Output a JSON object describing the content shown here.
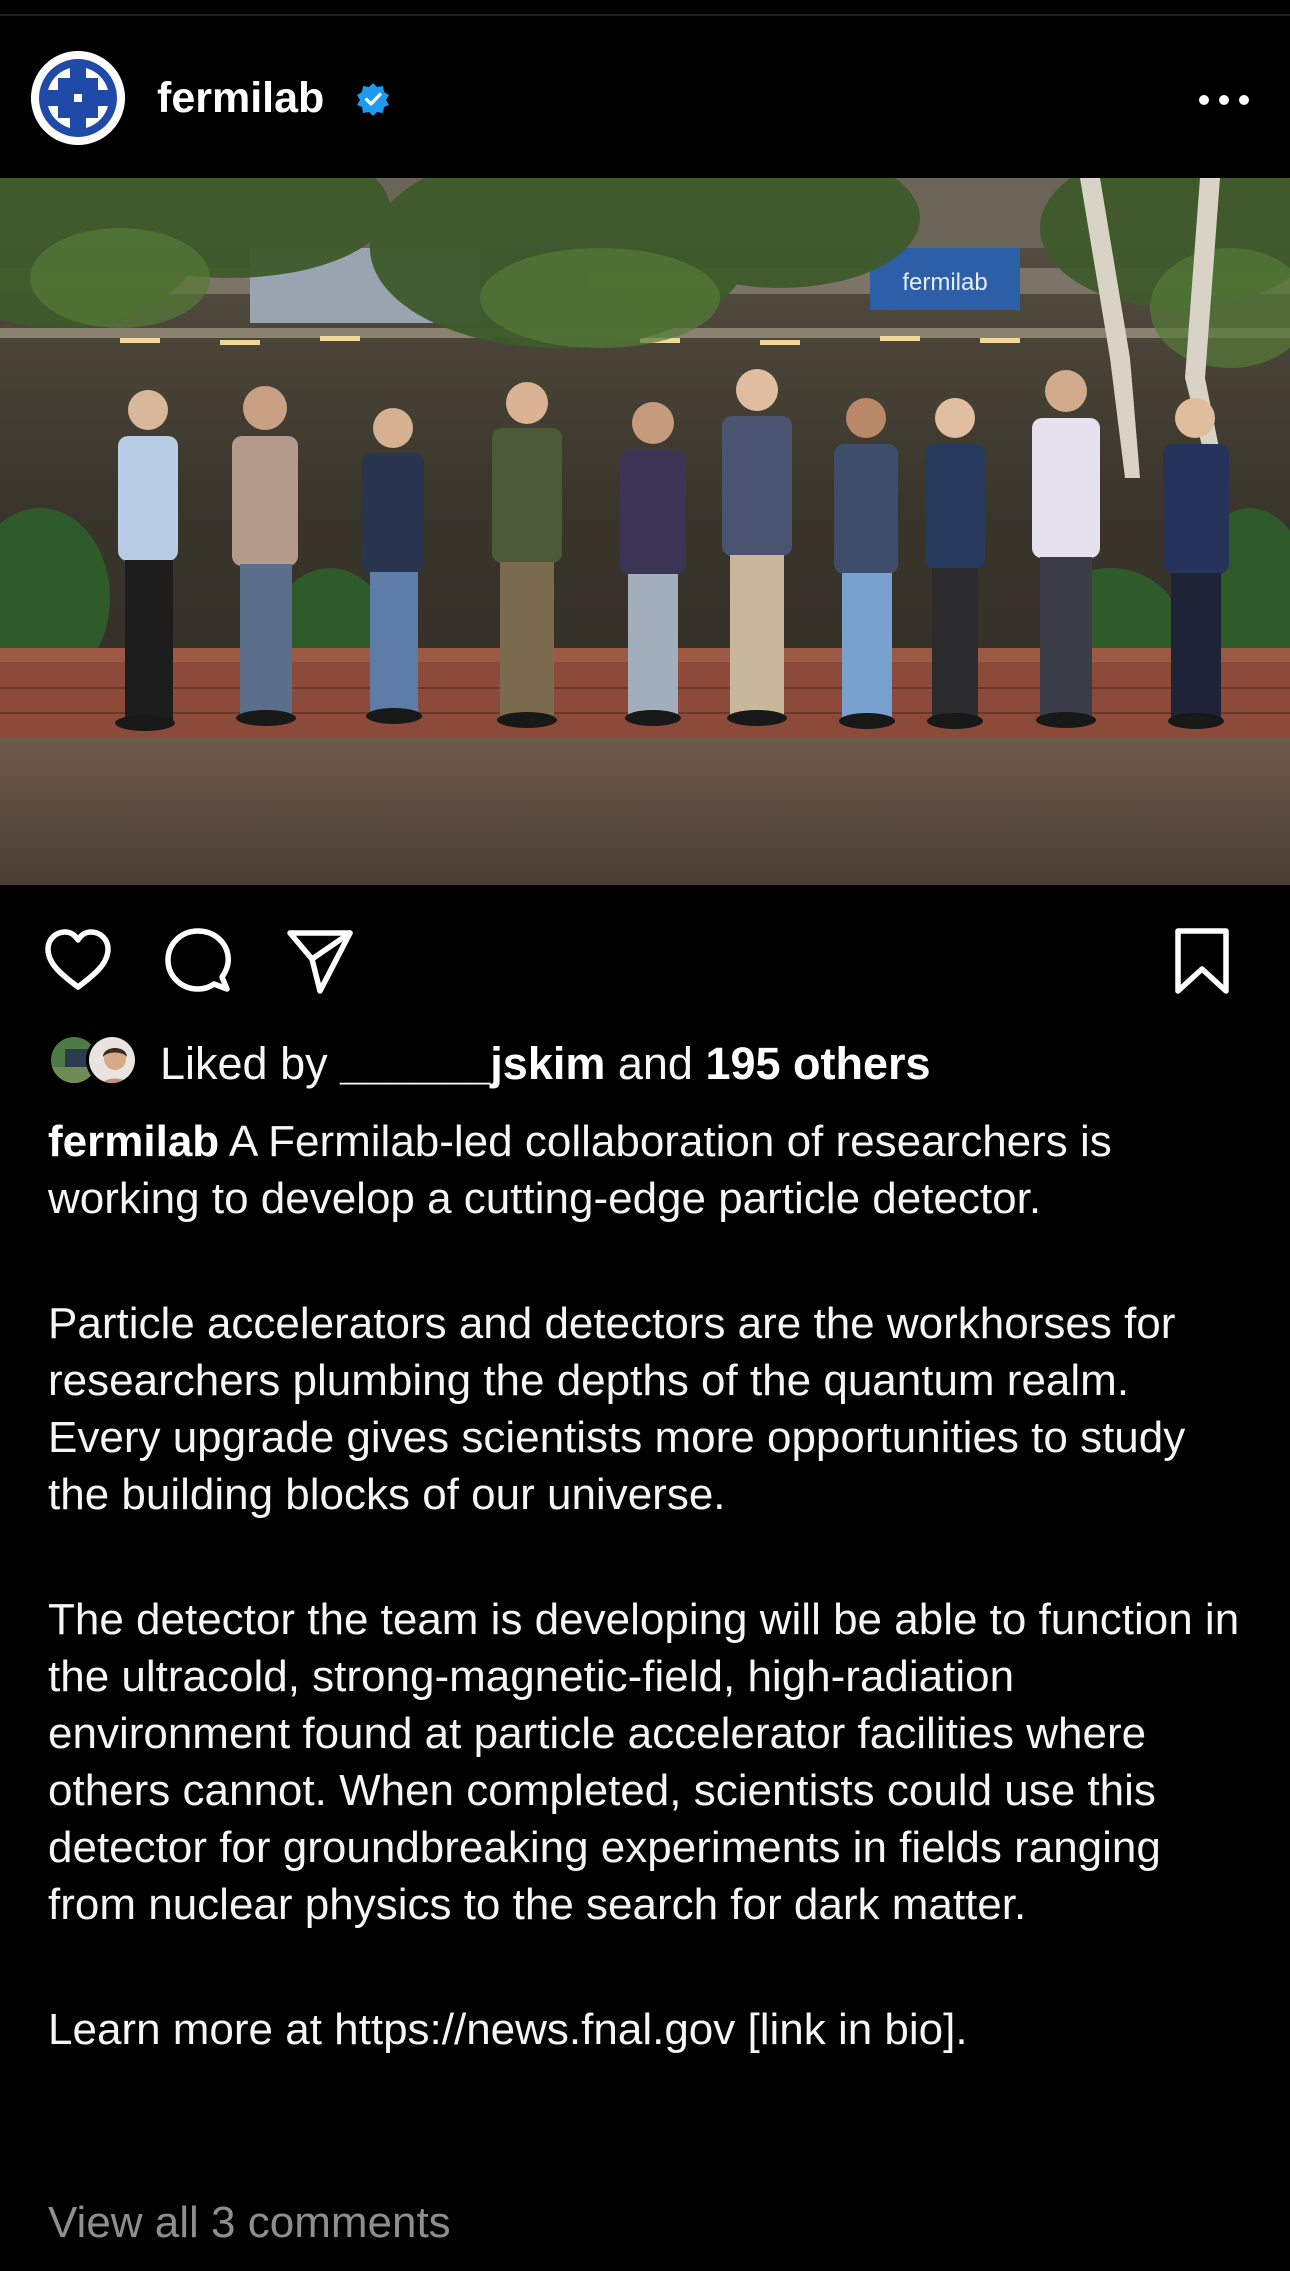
{
  "post": {
    "username": "fermilab",
    "verified_icon": "verified-badge-icon",
    "more_icon": "more-horizontal-icon",
    "photo_sign_text": "fermilab"
  },
  "actions": {
    "like_icon": "heart-icon",
    "comment_icon": "comment-bubble-icon",
    "share_icon": "paper-plane-icon",
    "save_icon": "bookmark-icon"
  },
  "likes": {
    "prefix": "Liked by ",
    "liker": "______jskim",
    "middle": " and ",
    "count_text": "195 others"
  },
  "caption": {
    "owner": "fermilab",
    "paragraph1": " A Fermilab-led collaboration of researchers is working to develop a cutting-edge particle detector.",
    "paragraph2": "Particle accelerators and detectors are the workhorses for researchers plumbing the depths of the quantum realm. Every upgrade gives scientists more opportunities to study the building blocks of our universe.",
    "paragraph3": "The  detector the team is developing will be able to function in the ultracold, strong-magnetic-field, high-radiation environment found at particle accelerator facilities where others cannot. When completed, scientists could use this detector for groundbreaking experiments in fields ranging from nuclear physics to the search for dark matter.",
    "paragraph4": "Learn more at https://news.fnal.gov [link in bio]."
  },
  "comments": {
    "view_all": "View all 3 comments"
  },
  "colors": {
    "background": "#000000",
    "text": "#f5f5f5",
    "muted": "#8e8e8e",
    "verified": "#1d9bf0",
    "fermilab_blue": "#1f4aa8"
  }
}
